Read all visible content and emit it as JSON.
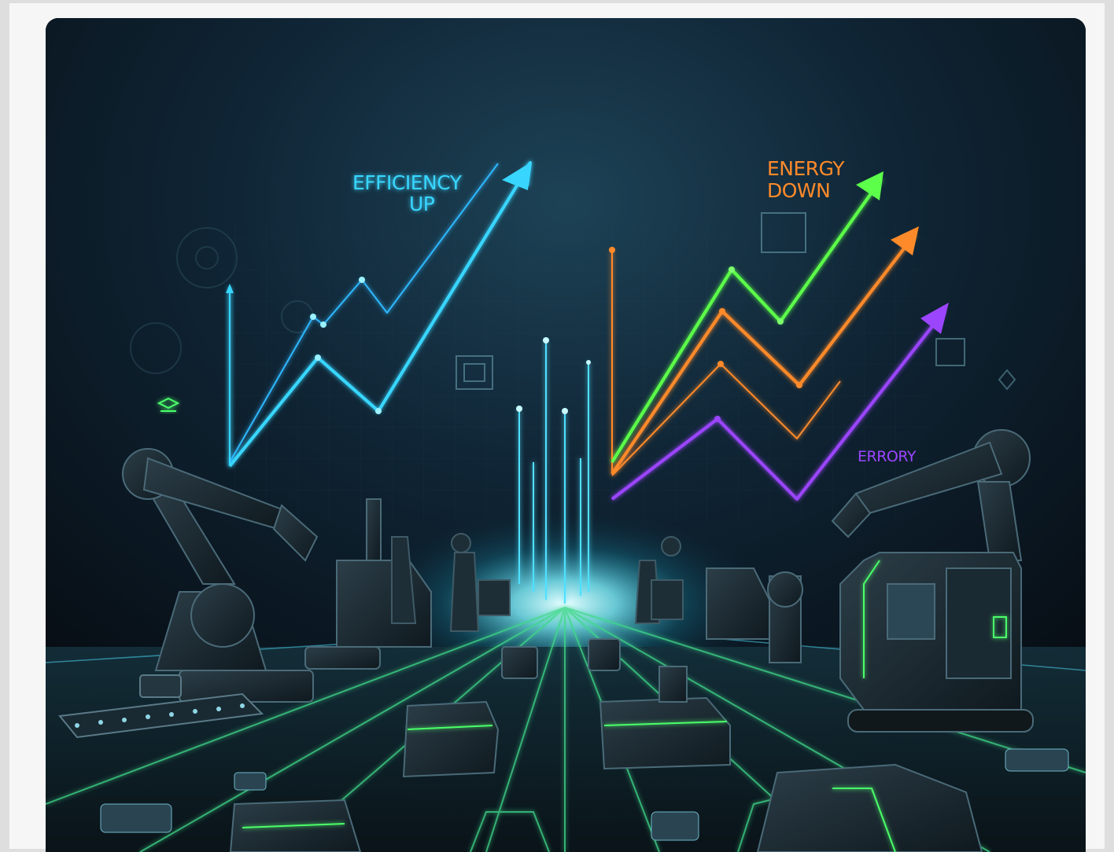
{
  "image": {
    "alt": "Futuristic factory floor with robotic arms, autonomous vehicles and neon rising arrow graphs",
    "labels": {
      "efficiency_line1": "EFFICIENCY",
      "efficiency_line2": "UP",
      "energy_line1": "ENERGY",
      "energy_line2": "DOWN",
      "error": "ERRORY"
    },
    "colors": {
      "cyan": "#38d6ff",
      "green": "#5cff4a",
      "orange": "#ff8a2a",
      "purple": "#9b45ff",
      "background": "#0c1620"
    }
  }
}
